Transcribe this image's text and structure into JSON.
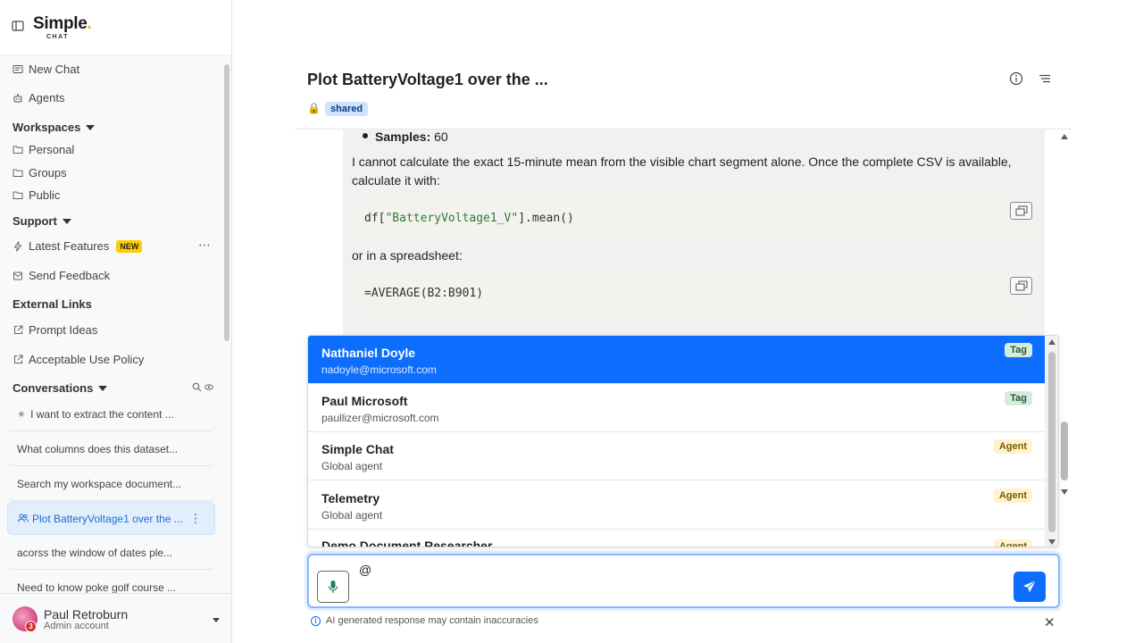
{
  "app": {
    "logo_text": "Simple",
    "logo_sub": "CHAT"
  },
  "sidebar": {
    "new_chat": "New Chat",
    "agents": "Agents",
    "workspaces_header": "Workspaces",
    "workspaces": [
      "Personal",
      "Groups",
      "Public"
    ],
    "support_header": "Support",
    "latest_features": "Latest Features",
    "new_badge": "NEW",
    "send_feedback": "Send Feedback",
    "external_header": "External Links",
    "prompt_ideas": "Prompt Ideas",
    "acceptable_use": "Acceptable Use Policy",
    "conversations_header": "Conversations",
    "conversations": [
      "I want to extract the content ...",
      "What columns does this dataset...",
      "Search my workspace document...",
      "Plot BatteryVoltage1 over the ...",
      "acorss the window of dates ple...",
      "Need to know poke golf course ..."
    ]
  },
  "user": {
    "name": "Paul Retroburn",
    "role": "Admin account",
    "notifications": "3"
  },
  "chat": {
    "title": "Plot BatteryVoltage1 over the ...",
    "shared_badge": "shared",
    "samples_label": "Samples:",
    "samples_value": " 60",
    "para1": "I cannot calculate the exact 15-minute mean from the visible chart segment alone. Once the complete CSV is available, calculate it with:",
    "code1_prefix": "df[",
    "code1_string": "\"BatteryVoltage1_V\"",
    "code1_suffix": "].mean()",
    "para2": "or in a spreadsheet:",
    "code2": "=AVERAGE(B2:B901)"
  },
  "mentions": [
    {
      "name": "Nathaniel Doyle",
      "sub": "nadoyle@microsoft.com",
      "type": "Tag"
    },
    {
      "name": "Paul Microsoft",
      "sub": "paullizer@microsoft.com",
      "type": "Tag"
    },
    {
      "name": "Simple Chat",
      "sub": "Global agent",
      "type": "Agent"
    },
    {
      "name": "Telemetry",
      "sub": "Global agent",
      "type": "Agent"
    },
    {
      "name": "Demo Document Researcher",
      "sub": "",
      "type": "Agent"
    }
  ],
  "composer": {
    "value": "@",
    "disclaimer": "AI generated response may contain inaccuracies"
  },
  "colors": {
    "accent": "#0d6efd",
    "new_badge": "#ffcc00",
    "active_conv": "#e3eefc"
  },
  "icons": [
    "sidebar-toggle-icon",
    "chat-icon",
    "agent-icon",
    "folder-icon",
    "bolt-icon",
    "feedback-icon",
    "external-link-icon",
    "search-icon",
    "eye-icon",
    "pin-icon",
    "people-icon",
    "info-icon",
    "menu-icon",
    "copy-icon",
    "mic-icon",
    "send-icon",
    "close-icon",
    "lock-icon"
  ]
}
